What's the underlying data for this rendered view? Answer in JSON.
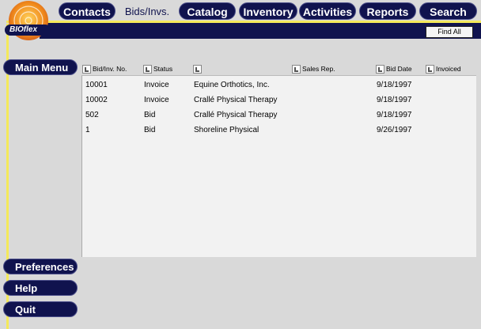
{
  "nav_tabs": [
    {
      "label": "Contacts"
    },
    {
      "label": "Bids/Invs."
    },
    {
      "label": "Catalog"
    },
    {
      "label": "Inventory"
    },
    {
      "label": "Activities"
    },
    {
      "label": "Reports"
    },
    {
      "label": "Search"
    }
  ],
  "logo": {
    "text": "BIOflex"
  },
  "toolbar": {
    "find_all_label": "Find All"
  },
  "sidebar": {
    "main_menu": "Main Menu",
    "preferences": "Preferences",
    "help": "Help",
    "quit": "Quit"
  },
  "columns": {
    "bid_no": "Bid/Inv. No.",
    "status": "Status",
    "customer": "",
    "sales_rep": "Sales Rep.",
    "bid_date": "Bid Date",
    "invoiced": "Invoiced"
  },
  "rows": [
    {
      "number": "10001",
      "status": "Invoice",
      "customer": "Equine Orthotics, Inc.",
      "date": "9/18/1997"
    },
    {
      "number": "10002",
      "status": "Invoice",
      "customer": "Crallé Physical Therapy",
      "date": "9/18/1997"
    },
    {
      "number": "502",
      "status": "Bid",
      "customer": "Crallé Physical Therapy",
      "date": "9/18/1997"
    },
    {
      "number": "1",
      "status": "Bid",
      "customer": "Shoreline Physical",
      "date": "9/26/1997"
    }
  ],
  "colors": {
    "navy": "#10134e",
    "yellow": "#f4e95a",
    "logo_orange": "#f08a1c"
  }
}
